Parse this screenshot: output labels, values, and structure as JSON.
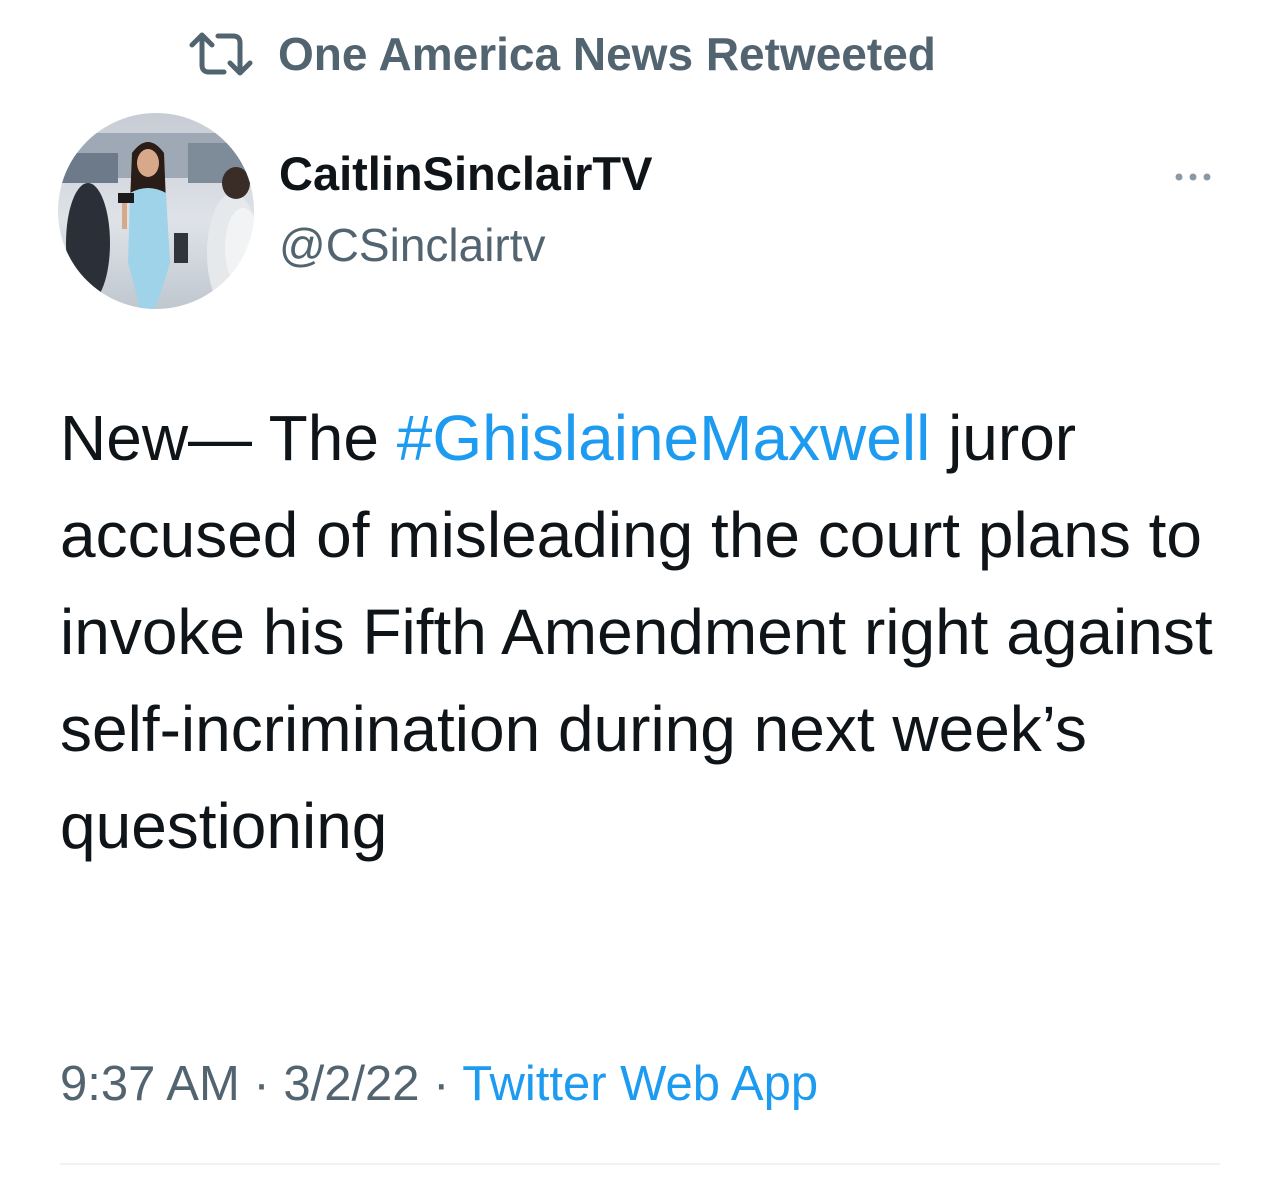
{
  "social_context": {
    "icon": "retweet-icon",
    "label": "One America News Retweeted"
  },
  "author": {
    "display_name": "CaitlinSinclairTV",
    "handle": "@CSinclairtv",
    "avatar": "avatar-photo"
  },
  "more_icon": "more-horizontal-icon",
  "tweet": {
    "text_before": "New— The ",
    "hashtag": "#GhislaineMaxwell",
    "text_after": " juror accused of misleading the court plans to invoke his Fifth Amendment right against self-incrimination during next week’s questioning"
  },
  "meta": {
    "time": "9:37 AM",
    "sep1": " · ",
    "date": "3/2/22",
    "sep2": " · ",
    "source": "Twitter Web App"
  },
  "colors": {
    "link": "#1d9bf0",
    "secondary_text": "#536471",
    "primary_text": "#0f1419",
    "divider": "#eff3f4"
  }
}
